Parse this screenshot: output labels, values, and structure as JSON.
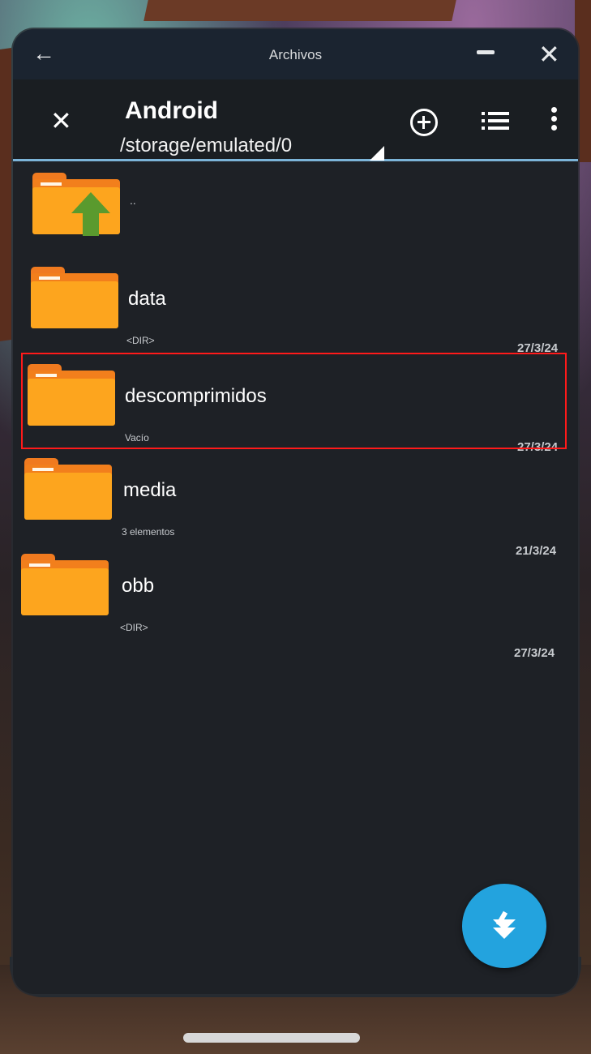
{
  "window": {
    "title": "Archivos",
    "back_icon": "arrow-left-icon",
    "minimize_icon": "minimize-icon",
    "close_icon": "close-icon"
  },
  "appbar": {
    "close_symbol": "✕",
    "title": "Android",
    "path": "/storage/emulated/0",
    "actions": [
      "add-circle-icon",
      "list-view-icon",
      "more-vert-icon"
    ]
  },
  "files": [
    {
      "name": "..",
      "meta": "",
      "date": "",
      "icon": "folder-up-icon"
    },
    {
      "name": "data",
      "meta": "<DIR>",
      "date": "27/3/24",
      "icon": "folder-icon"
    },
    {
      "name": "descomprimidos",
      "meta": "Vacío",
      "date": "27/3/24",
      "icon": "folder-icon",
      "highlighted": true
    },
    {
      "name": "media",
      "meta": "3 elementos",
      "date": "21/3/24",
      "icon": "folder-icon"
    },
    {
      "name": "obb",
      "meta": "<DIR>",
      "date": "27/3/24",
      "icon": "folder-icon"
    }
  ],
  "fab": {
    "icon": "download-icon"
  },
  "colors": {
    "panel": "#1e2126",
    "accent": "#23a3de",
    "folder": "#fda51e",
    "highlight": "#ff1a1a"
  }
}
